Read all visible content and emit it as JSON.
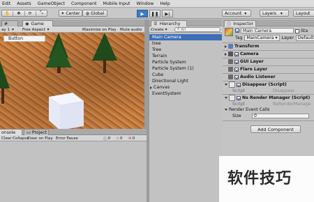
{
  "menu": [
    "Edit",
    "Assets",
    "GameObject",
    "Component",
    "Mobile Input",
    "Window",
    "Help"
  ],
  "toolbar": {
    "pivot_label": "Center",
    "space_label": "Global",
    "account_label": "Account",
    "layers_label": "Layers",
    "layout_label": "Layout"
  },
  "colors": {
    "accent_blue": "#3e7bc4",
    "selection": "#3d6fb6",
    "terrain": "#b56a33"
  },
  "game": {
    "tab_label": "Game",
    "display": "ay 1",
    "aspect": "Free Aspect",
    "maximize": "Maximize on Play",
    "mute": "Mute audio",
    "ui_button": "Button"
  },
  "hierarchy": {
    "tab_label": "Hierarchy",
    "create": "Create",
    "search_placeholder": "All",
    "items": [
      "Main Camera",
      "tree",
      "Tree",
      "Terrain",
      "Particle System",
      "Particle System (1)",
      "Cube",
      "Directional Light",
      "Canvas",
      "EventSystem"
    ]
  },
  "inspector": {
    "tab_label": "Inspector",
    "object_name": "Main Camera",
    "static_label": "Sta",
    "tag_label": "Tag",
    "tag_value": "MainCamera",
    "layer_label": "Layer",
    "layer_value": "Default",
    "components": [
      "Transform",
      "Camera",
      "GUI Layer",
      "Flare Layer",
      "Audio Listener",
      "Disappear (Script)",
      "Ns Render Manager (Script)"
    ],
    "script_label": "Script",
    "script1_value": "Disappear",
    "script2_value": "NsRenderManage",
    "render_event_calls": "Render Event Calls",
    "size_label": "Size",
    "size_value": "0",
    "add_component": "Add Component"
  },
  "console": {
    "tab_label": "onsole",
    "project_tab": "Project",
    "clear": "Clear",
    "collapse": "Collapse",
    "clear_on_play": "Clear on Play",
    "error_pause": "Error Pause",
    "count_info": "0",
    "count_warn": "0",
    "count_error": "0"
  },
  "watermark": "软件技巧"
}
